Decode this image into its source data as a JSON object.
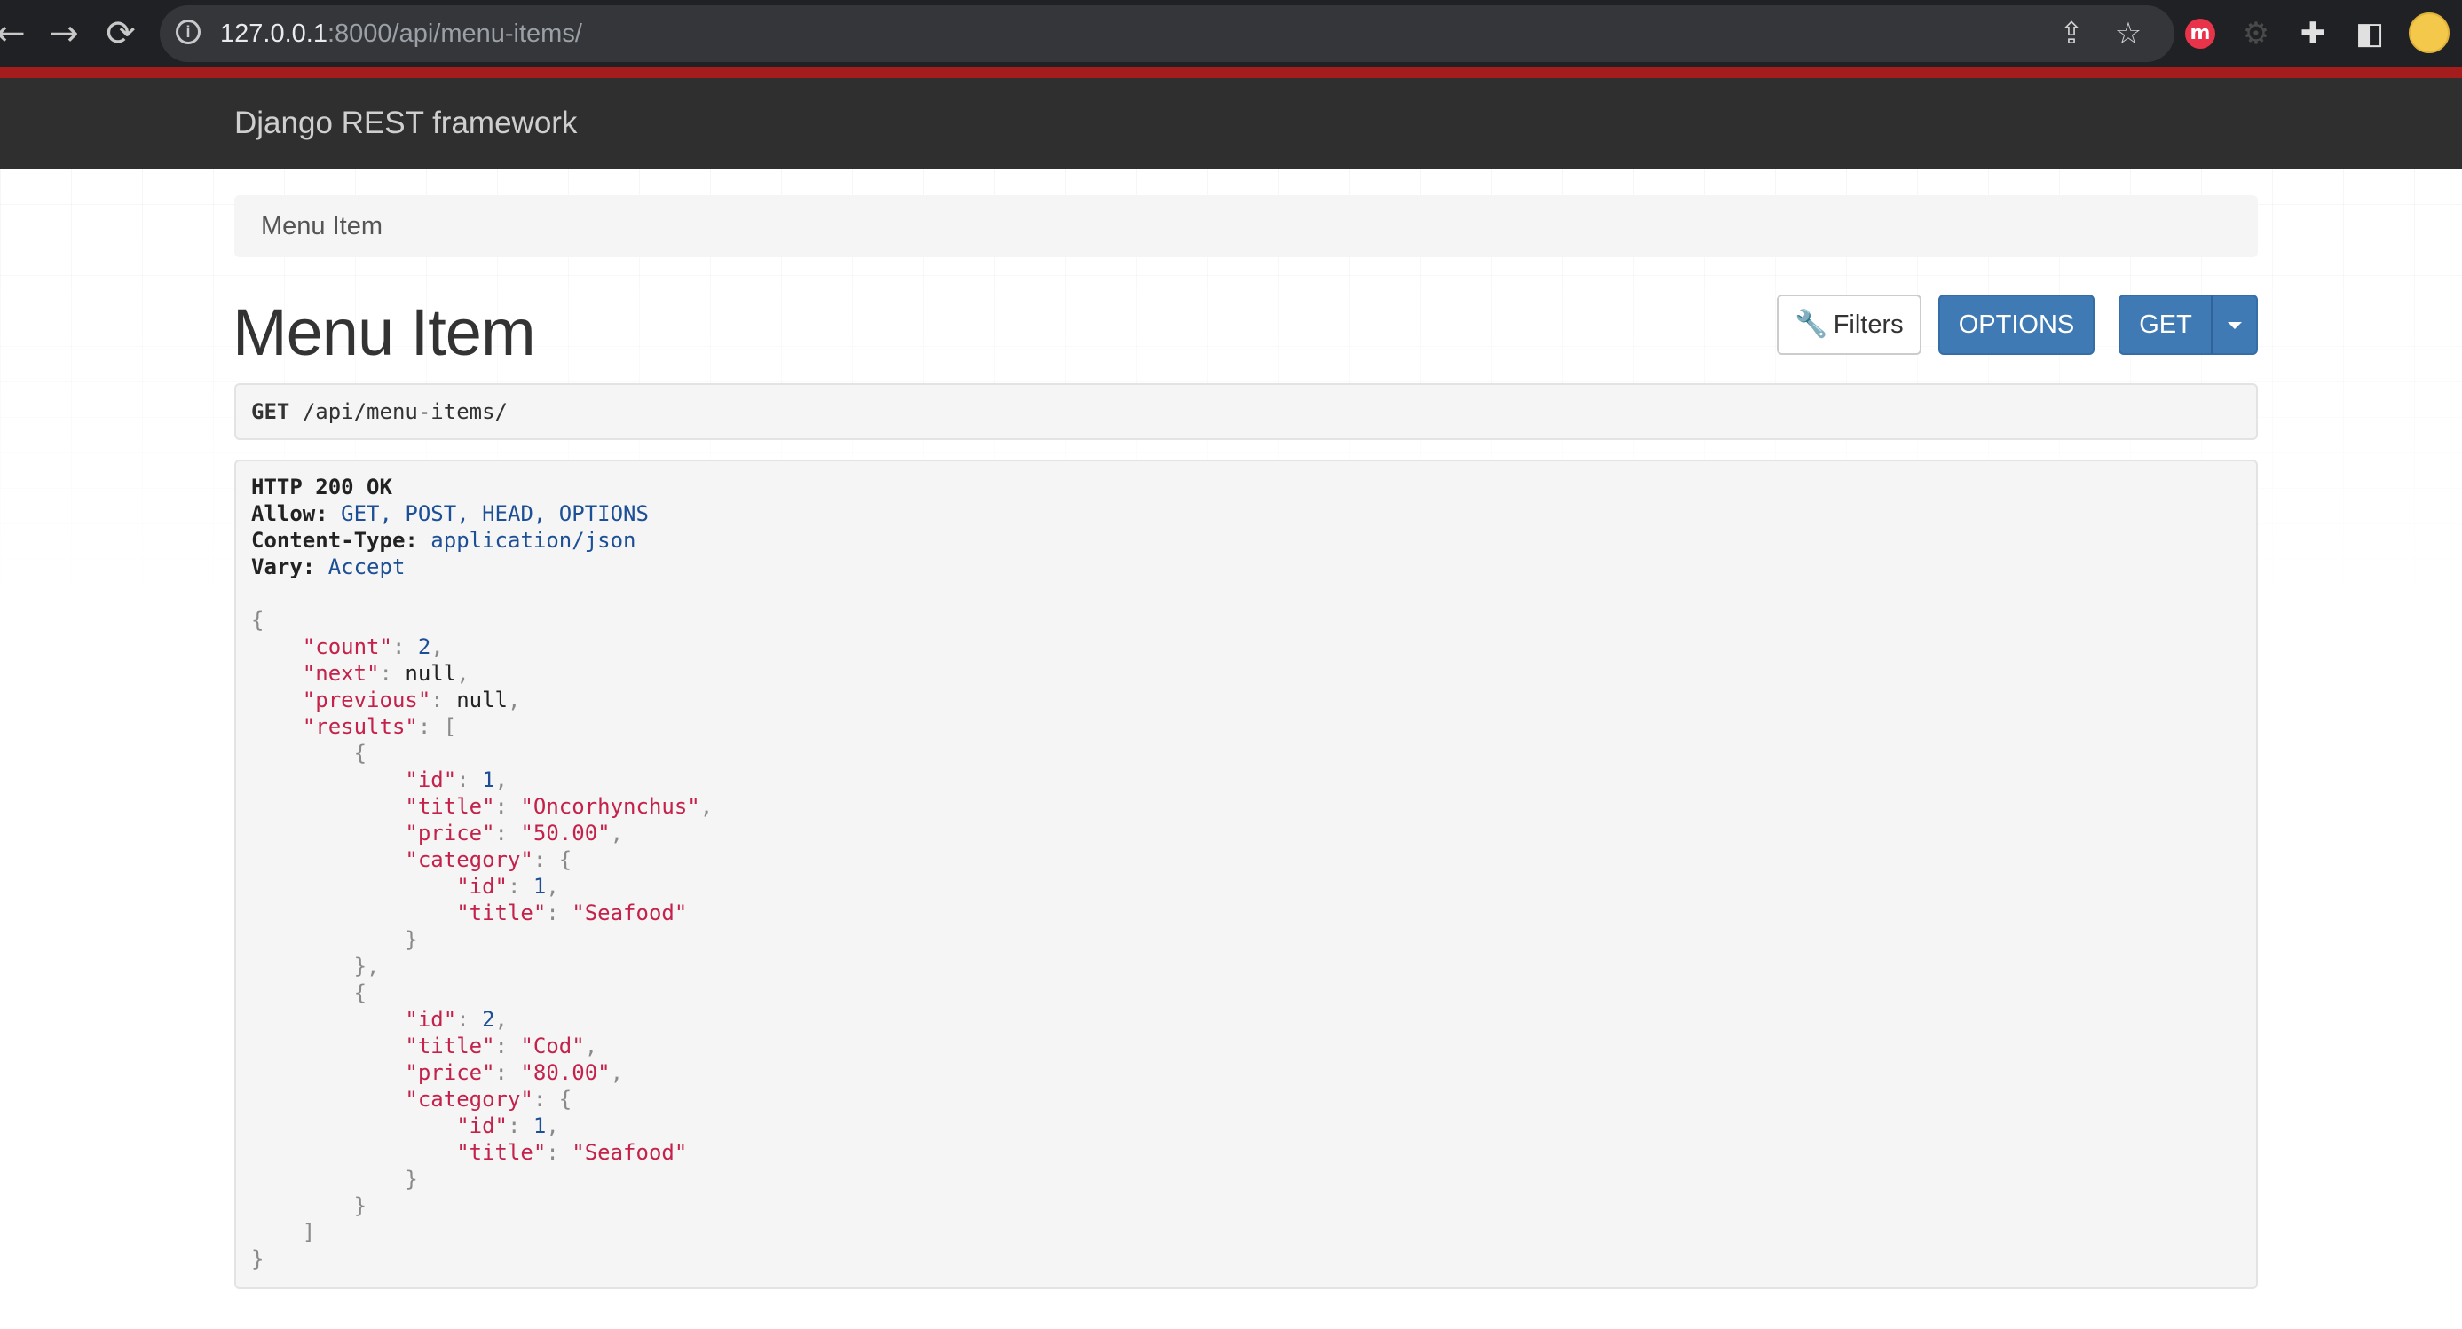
{
  "browser": {
    "url_host": "127.0.0.1",
    "url_path": ":8000/api/menu-items/",
    "back_glyph": "←",
    "forward_glyph": "→",
    "reload_glyph": "⟳",
    "share_glyph": "⇪",
    "star_glyph": "☆",
    "ext_m_label": "m",
    "puzzle_glyph": "✚",
    "sidepanel_glyph": "◧",
    "info_glyph": "i"
  },
  "navbar": {
    "brand": "Django REST framework"
  },
  "breadcrumb": {
    "items": [
      "Menu Item"
    ]
  },
  "page": {
    "title": "Menu Item"
  },
  "toolbar": {
    "filters_label": "Filters",
    "wrench_glyph": "🔧",
    "options_label": "OPTIONS",
    "get_label": "GET"
  },
  "request": {
    "method": "GET",
    "path": "/api/menu-items/"
  },
  "response": {
    "status": "HTTP 200 OK",
    "headers": [
      {
        "key": "Allow:",
        "value": "GET, POST, HEAD, OPTIONS"
      },
      {
        "key": "Content-Type:",
        "value": "application/json"
      },
      {
        "key": "Vary:",
        "value": "Accept"
      }
    ],
    "body": {
      "count": "2",
      "next": "null",
      "previous": "null",
      "results": [
        {
          "id": "1",
          "title": "\"Oncorhynchus\"",
          "price": "\"50.00\"",
          "category": {
            "id": "1",
            "title": "\"Seafood\""
          }
        },
        {
          "id": "2",
          "title": "\"Cod\"",
          "price": "\"80.00\"",
          "category": {
            "id": "1",
            "title": "\"Seafood\""
          }
        }
      ]
    }
  },
  "colors": {
    "navbar_bg": "#2f2f2f",
    "accent_red": "#a51c1c",
    "button_blue": "#3f7ab5",
    "json_key": "#c4224a",
    "json_number": "#1c4f96"
  }
}
